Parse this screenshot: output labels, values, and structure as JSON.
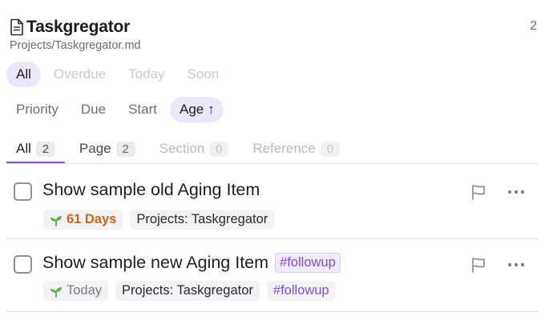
{
  "header": {
    "title": "Taskgregator",
    "path": "Projects/Taskgregator.md",
    "count": "2",
    "icon": "document-icon"
  },
  "filters": [
    {
      "label": "All",
      "active": true
    },
    {
      "label": "Overdue",
      "active": false
    },
    {
      "label": "Today",
      "active": false
    },
    {
      "label": "Soon",
      "active": false
    }
  ],
  "sort": [
    {
      "label": "Priority",
      "active": false
    },
    {
      "label": "Due",
      "active": false
    },
    {
      "label": "Start",
      "active": false
    },
    {
      "label": "Age ↑",
      "active": true
    }
  ],
  "tabs": [
    {
      "label": "All",
      "count": "2",
      "state": "active"
    },
    {
      "label": "Page",
      "count": "2",
      "state": "normal"
    },
    {
      "label": "Section",
      "count": "0",
      "state": "dim"
    },
    {
      "label": "Reference",
      "count": "0",
      "state": "dim"
    }
  ],
  "tasks": [
    {
      "title": "Show sample old Aging Item",
      "age": "61 Days",
      "project": "Projects: Taskgregator",
      "age_icon": "sprout-icon",
      "flag_icon": "flag-icon",
      "more_icon": "more-horizontal-icon"
    },
    {
      "title": "Show sample new Aging Item",
      "inline_tag": "#followup",
      "age": "Today",
      "project": "Projects: Taskgregator",
      "tag": "#followup",
      "age_icon": "sprout-icon",
      "flag_icon": "flag-icon",
      "more_icon": "more-horizontal-icon"
    }
  ],
  "colors": {
    "accent": "#7c4fe0",
    "pill_active_bg": "#ece6fa",
    "age_old": "#c9661a"
  }
}
